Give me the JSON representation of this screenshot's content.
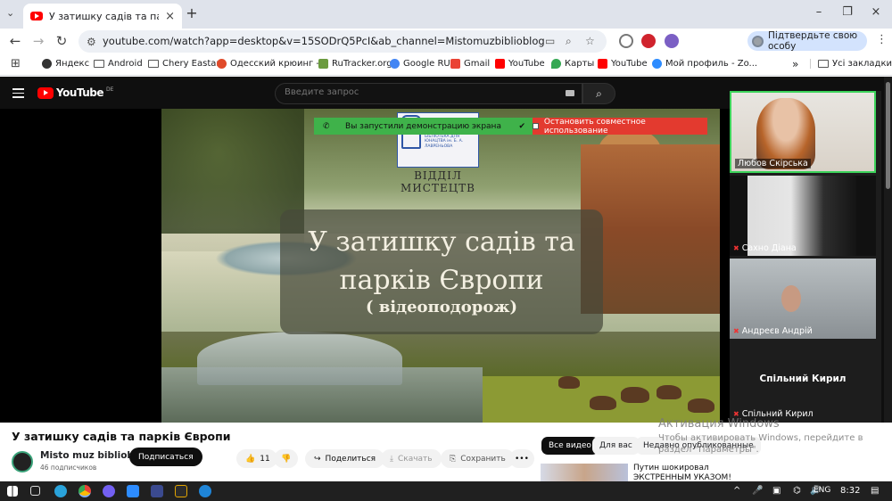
{
  "browser": {
    "tab_title": "У затишку садів та парків Європи",
    "tab_close": "×",
    "new_tab": "+",
    "url": "youtube.com/watch?app=desktop&v=15SODrQ5PcI&ab_channel=Mistomuzbiblioblog",
    "profile_chip": "Підтвердьте свою особу",
    "window_controls": [
      "–",
      "❐",
      "×"
    ]
  },
  "bookmarks": {
    "items": [
      {
        "label": "Яндекс",
        "icon": "yandex-icon"
      },
      {
        "label": "Android",
        "icon": "folder-icon"
      },
      {
        "label": "Chery Eastar",
        "icon": "folder-icon"
      },
      {
        "label": "Одесский крюинг -...",
        "icon": "site-icon"
      },
      {
        "label": "RuTracker.org",
        "icon": "rutracker-icon"
      },
      {
        "label": "Google RU",
        "icon": "google-icon"
      },
      {
        "label": "Gmail",
        "icon": "gmail-icon"
      },
      {
        "label": "YouTube",
        "icon": "youtube-icon"
      },
      {
        "label": "Карты",
        "icon": "maps-icon"
      },
      {
        "label": "YouTube",
        "icon": "youtube-icon"
      },
      {
        "label": "Мой профиль - Zo...",
        "icon": "zoom-icon"
      }
    ],
    "more": "»",
    "all_bookmarks": "Усі закладки"
  },
  "youtube": {
    "logo_text": "YouTube",
    "logo_region": "DE",
    "search_placeholder": "Введите запрос",
    "video_title": "У затишку садів та парків Європи",
    "channel_name": "Misto muz biblioblog",
    "subscribers": "46 подписчиков",
    "subscribe_label": "Подписаться",
    "likes": "11",
    "share_label": "Поделиться",
    "download_label": "Скачать",
    "save_label": "Сохранить",
    "more_label": "•••",
    "chips": [
      "Все видео",
      "Для вас",
      "Недавно опубликованные"
    ],
    "recommended_title": "Путин шокировал ЭКСТРЕННЫМ УКАЗОМ! Все"
  },
  "slide": {
    "title_line1": "У затишку садів та",
    "title_line2": "парків Європи",
    "subtitle": "( відеоподорож)",
    "logo_text": "ХЕРСОНСЬКА ОБЛАСНА БІБЛІОТЕКА ДЛЯ ЮНАЦТВА ім. Б. А. ЛАВРЕНЬОВА",
    "logo_caption_1": "ВІДДІЛ",
    "logo_caption_2": "МИСТЕЦТВ",
    "share_on_text": "Вы запустили демонстрацию экрана",
    "share_stop_text": "Остановить совместное использование"
  },
  "participants": [
    {
      "name": "Любов Скірська",
      "muted": false,
      "active": true
    },
    {
      "name": "Сахно Діана",
      "muted": true,
      "active": false
    },
    {
      "name": "Андреєв Андрій",
      "muted": true,
      "active": false
    },
    {
      "name": "Спільний Кирил",
      "muted": true,
      "active": false,
      "display_name": "Спільний Кирил"
    }
  ],
  "windows": {
    "watermark_title": "Активация Windows",
    "watermark_text": "Чтобы активировать Windows, перейдите в раздел \"Параметры\".",
    "lang": "ENG",
    "time": "8:32"
  },
  "colors": {
    "youtube_red": "#ff0000",
    "share_green": "#3fb24a",
    "share_red": "#e33a2f",
    "active_speaker": "#3cd35a"
  }
}
